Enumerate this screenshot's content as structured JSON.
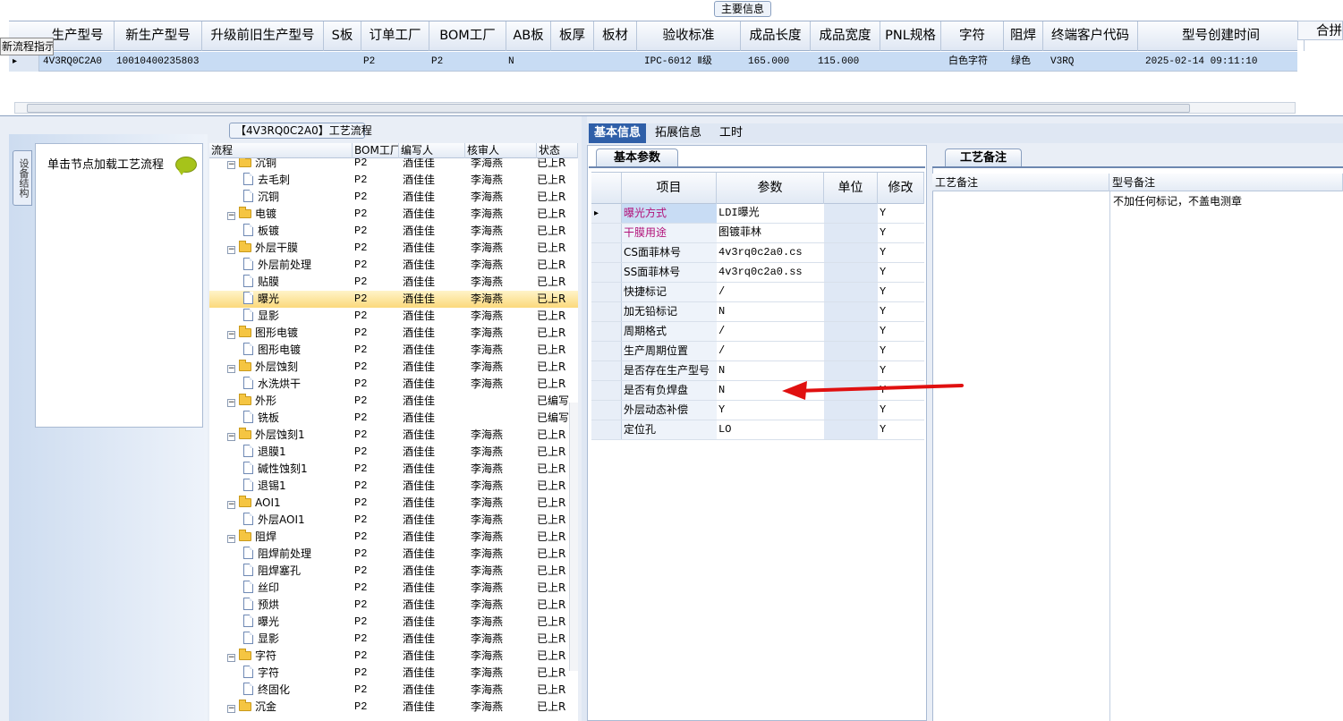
{
  "top": {
    "caption": "主要信息",
    "tooltip": "新流程指示",
    "columns": [
      "生产型号",
      "新生产型号",
      "升级前旧生产型号",
      "S板",
      "订单工厂",
      "BOM工厂",
      "AB板",
      "板厚",
      "板材",
      "验收标准",
      "成品长度",
      "成品宽度",
      "PNL规格",
      "字符",
      "阻焊",
      "终端客户代码",
      "型号创建时间"
    ],
    "extra_column": "合拼",
    "row": {
      "indicator": "▸",
      "values": [
        "4V3RQ0C2A0",
        "10010400235803",
        "",
        "",
        "P2",
        "P2",
        "N",
        "",
        "",
        "IPC-6012 Ⅱ级",
        "165.000",
        "115.000",
        "",
        "白色字符",
        "绿色",
        "V3RQ",
        "2025-02-14 09:11:10"
      ]
    }
  },
  "left": {
    "vtab": "设备结构",
    "title": "单击节点加载工艺流程"
  },
  "flow": {
    "caption": "【4V3RQ0C2A0】工艺流程",
    "headers": [
      "流程",
      "BOM工厂",
      "编写人",
      "核审人",
      "状态"
    ],
    "rows": [
      {
        "level": 0,
        "name": "沉铜",
        "bom": "P2",
        "writer": "酒佳佳",
        "reviewer": "李海燕",
        "status": "已上R"
      },
      {
        "level": 1,
        "name": "去毛刺",
        "bom": "P2",
        "writer": "酒佳佳",
        "reviewer": "李海燕",
        "status": "已上R"
      },
      {
        "level": 1,
        "name": "沉铜",
        "bom": "P2",
        "writer": "酒佳佳",
        "reviewer": "李海燕",
        "status": "已上R"
      },
      {
        "level": 0,
        "name": "电镀",
        "bom": "P2",
        "writer": "酒佳佳",
        "reviewer": "李海燕",
        "status": "已上R"
      },
      {
        "level": 1,
        "name": "板镀",
        "bom": "P2",
        "writer": "酒佳佳",
        "reviewer": "李海燕",
        "status": "已上R"
      },
      {
        "level": 0,
        "name": "外层干膜",
        "bom": "P2",
        "writer": "酒佳佳",
        "reviewer": "李海燕",
        "status": "已上R"
      },
      {
        "level": 1,
        "name": "外层前处理",
        "bom": "P2",
        "writer": "酒佳佳",
        "reviewer": "李海燕",
        "status": "已上R"
      },
      {
        "level": 1,
        "name": "贴膜",
        "bom": "P2",
        "writer": "酒佳佳",
        "reviewer": "李海燕",
        "status": "已上R"
      },
      {
        "level": 1,
        "name": "曝光",
        "bom": "P2",
        "writer": "酒佳佳",
        "reviewer": "李海燕",
        "status": "已上R",
        "selected": true
      },
      {
        "level": 1,
        "name": "显影",
        "bom": "P2",
        "writer": "酒佳佳",
        "reviewer": "李海燕",
        "status": "已上R"
      },
      {
        "level": 0,
        "name": "图形电镀",
        "bom": "P2",
        "writer": "酒佳佳",
        "reviewer": "李海燕",
        "status": "已上R"
      },
      {
        "level": 1,
        "name": "图形电镀",
        "bom": "P2",
        "writer": "酒佳佳",
        "reviewer": "李海燕",
        "status": "已上R"
      },
      {
        "level": 0,
        "name": "外层蚀刻",
        "bom": "P2",
        "writer": "酒佳佳",
        "reviewer": "李海燕",
        "status": "已上R"
      },
      {
        "level": 1,
        "name": "水洗烘干",
        "bom": "P2",
        "writer": "酒佳佳",
        "reviewer": "李海燕",
        "status": "已上R"
      },
      {
        "level": 0,
        "name": "外形",
        "bom": "P2",
        "writer": "酒佳佳",
        "reviewer": "",
        "status": "已编写"
      },
      {
        "level": 1,
        "name": "铣板",
        "bom": "P2",
        "writer": "酒佳佳",
        "reviewer": "",
        "status": "已编写"
      },
      {
        "level": 0,
        "name": "外层蚀刻1",
        "bom": "P2",
        "writer": "酒佳佳",
        "reviewer": "李海燕",
        "status": "已上R"
      },
      {
        "level": 1,
        "name": "退膜1",
        "bom": "P2",
        "writer": "酒佳佳",
        "reviewer": "李海燕",
        "status": "已上R"
      },
      {
        "level": 1,
        "name": "碱性蚀刻1",
        "bom": "P2",
        "writer": "酒佳佳",
        "reviewer": "李海燕",
        "status": "已上R"
      },
      {
        "level": 1,
        "name": "退锡1",
        "bom": "P2",
        "writer": "酒佳佳",
        "reviewer": "李海燕",
        "status": "已上R"
      },
      {
        "level": 0,
        "name": "AOI1",
        "bom": "P2",
        "writer": "酒佳佳",
        "reviewer": "李海燕",
        "status": "已上R"
      },
      {
        "level": 1,
        "name": "外层AOI1",
        "bom": "P2",
        "writer": "酒佳佳",
        "reviewer": "李海燕",
        "status": "已上R"
      },
      {
        "level": 0,
        "name": "阻焊",
        "bom": "P2",
        "writer": "酒佳佳",
        "reviewer": "李海燕",
        "status": "已上R"
      },
      {
        "level": 1,
        "name": "阻焊前处理",
        "bom": "P2",
        "writer": "酒佳佳",
        "reviewer": "李海燕",
        "status": "已上R"
      },
      {
        "level": 1,
        "name": "阻焊塞孔",
        "bom": "P2",
        "writer": "酒佳佳",
        "reviewer": "李海燕",
        "status": "已上R"
      },
      {
        "level": 1,
        "name": "丝印",
        "bom": "P2",
        "writer": "酒佳佳",
        "reviewer": "李海燕",
        "status": "已上R"
      },
      {
        "level": 1,
        "name": "预烘",
        "bom": "P2",
        "writer": "酒佳佳",
        "reviewer": "李海燕",
        "status": "已上R"
      },
      {
        "level": 1,
        "name": "曝光",
        "bom": "P2",
        "writer": "酒佳佳",
        "reviewer": "李海燕",
        "status": "已上R"
      },
      {
        "level": 1,
        "name": "显影",
        "bom": "P2",
        "writer": "酒佳佳",
        "reviewer": "李海燕",
        "status": "已上R"
      },
      {
        "level": 0,
        "name": "字符",
        "bom": "P2",
        "writer": "酒佳佳",
        "reviewer": "李海燕",
        "status": "已上R"
      },
      {
        "level": 1,
        "name": "字符",
        "bom": "P2",
        "writer": "酒佳佳",
        "reviewer": "李海燕",
        "status": "已上R"
      },
      {
        "level": 1,
        "name": "终固化",
        "bom": "P2",
        "writer": "酒佳佳",
        "reviewer": "李海燕",
        "status": "已上R"
      },
      {
        "level": 0,
        "name": "沉金",
        "bom": "P2",
        "writer": "酒佳佳",
        "reviewer": "李海燕",
        "status": "已上R"
      }
    ]
  },
  "detail": {
    "tabs": [
      "基本信息",
      "拓展信息",
      "工时"
    ],
    "basic_tab": "基本参数",
    "headers": [
      "项目",
      "参数",
      "单位",
      "修改"
    ],
    "rows": [
      {
        "item": "曝光方式",
        "param": "LDI曝光",
        "unit": "",
        "edit": "Y",
        "magenta": true
      },
      {
        "item": "干膜用途",
        "param": "图镀菲林",
        "unit": "",
        "edit": "Y",
        "magenta": true
      },
      {
        "item": "CS面菲林号",
        "param": "4v3rq0c2a0.cs",
        "unit": "",
        "edit": "Y"
      },
      {
        "item": "SS面菲林号",
        "param": "4v3rq0c2a0.ss",
        "unit": "",
        "edit": "Y"
      },
      {
        "item": "快捷标记",
        "param": "/",
        "unit": "",
        "edit": "Y"
      },
      {
        "item": "加无铅标记",
        "param": "N",
        "unit": "",
        "edit": "Y"
      },
      {
        "item": "周期格式",
        "param": "/",
        "unit": "",
        "edit": "Y"
      },
      {
        "item": "生产周期位置",
        "param": "/",
        "unit": "",
        "edit": "Y"
      },
      {
        "item": "是否存在生产型号",
        "param": "N",
        "unit": "",
        "edit": "Y"
      },
      {
        "item": "是否有负焊盘",
        "param": "N",
        "unit": "",
        "edit": "Y"
      },
      {
        "item": "外层动态补偿",
        "param": "Y",
        "unit": "",
        "edit": "Y"
      },
      {
        "item": "定位孔",
        "param": "LO",
        "unit": "",
        "edit": "Y"
      }
    ]
  },
  "remark": {
    "tab": "工艺备注",
    "headers": [
      "工艺备注",
      "型号备注"
    ],
    "model_remark": "不加任何标记，不盖电测章"
  },
  "colors": {
    "accent": "#2f5fa8",
    "selected_row": "#c8dcf4",
    "arrow": "#e01010",
    "magenta_text": "#b2137a"
  }
}
